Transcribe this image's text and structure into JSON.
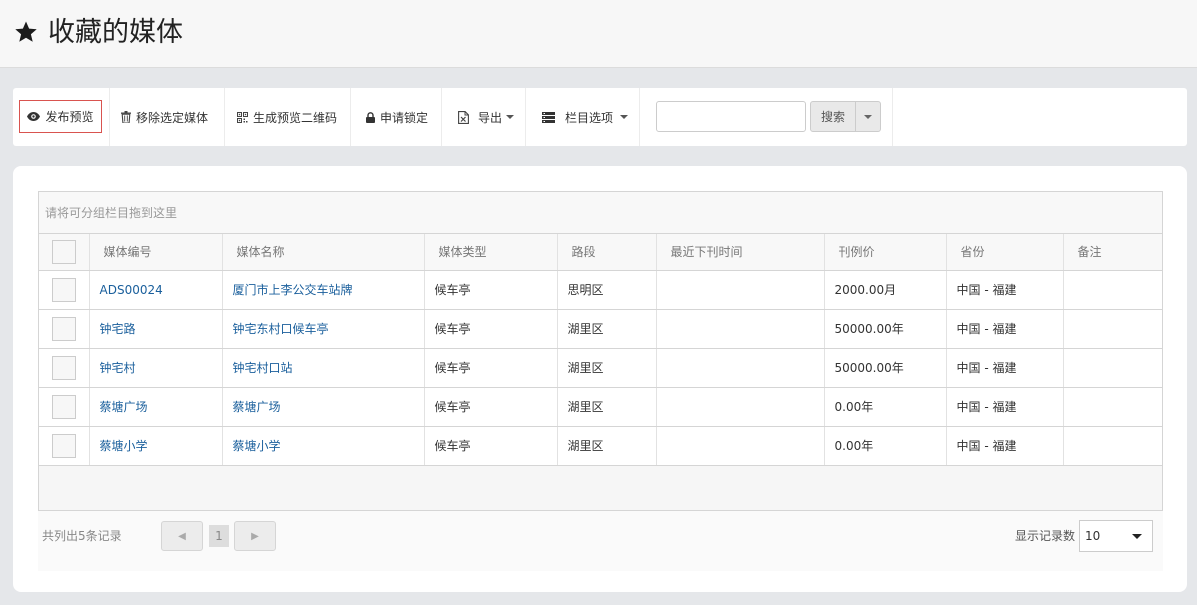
{
  "page": {
    "title": "收藏的媒体",
    "title_icon": "star-icon"
  },
  "toolbar": {
    "publish_preview": "发布预览",
    "remove_selected": "移除选定媒体",
    "generate_qr": "生成预览二维码",
    "request_lock": "申请锁定",
    "export": "导出",
    "column_options": "栏目选项",
    "search_placeholder": "",
    "search_button": "搜索"
  },
  "grid": {
    "group_hint": "请将可分组栏目拖到这里",
    "columns": [
      "媒体编号",
      "媒体名称",
      "媒体类型",
      "路段",
      "最近下刊时间",
      "刊例价",
      "省份",
      "备注"
    ],
    "rows": [
      {
        "code": "ADS00024",
        "name": "厦门市上李公交车站牌",
        "type": "候车亭",
        "road": "思明区",
        "last_date": "",
        "price": "2000.00月",
        "province": "中国 - 福建",
        "note": ""
      },
      {
        "code": "钟宅路",
        "name": "钟宅东村口候车亭",
        "type": "候车亭",
        "road": "湖里区",
        "last_date": "",
        "price": "50000.00年",
        "province": "中国 - 福建",
        "note": ""
      },
      {
        "code": "钟宅村",
        "name": "钟宅村口站",
        "type": "候车亭",
        "road": "湖里区",
        "last_date": "",
        "price": "50000.00年",
        "province": "中国 - 福建",
        "note": ""
      },
      {
        "code": "蔡塘广场",
        "name": "蔡塘广场",
        "type": "候车亭",
        "road": "湖里区",
        "last_date": "",
        "price": "0.00年",
        "province": "中国 - 福建",
        "note": ""
      },
      {
        "code": "蔡塘小学",
        "name": "蔡塘小学",
        "type": "候车亭",
        "road": "湖里区",
        "last_date": "",
        "price": "0.00年",
        "province": "中国 - 福建",
        "note": ""
      }
    ]
  },
  "footer": {
    "record_count": "共列出5条记录",
    "current_page": "1",
    "page_size_label": "显示记录数",
    "page_size": "10"
  },
  "colors": {
    "link": "#1a5f9c",
    "publish_border": "#d9534f",
    "background": "#e5e7ea"
  }
}
